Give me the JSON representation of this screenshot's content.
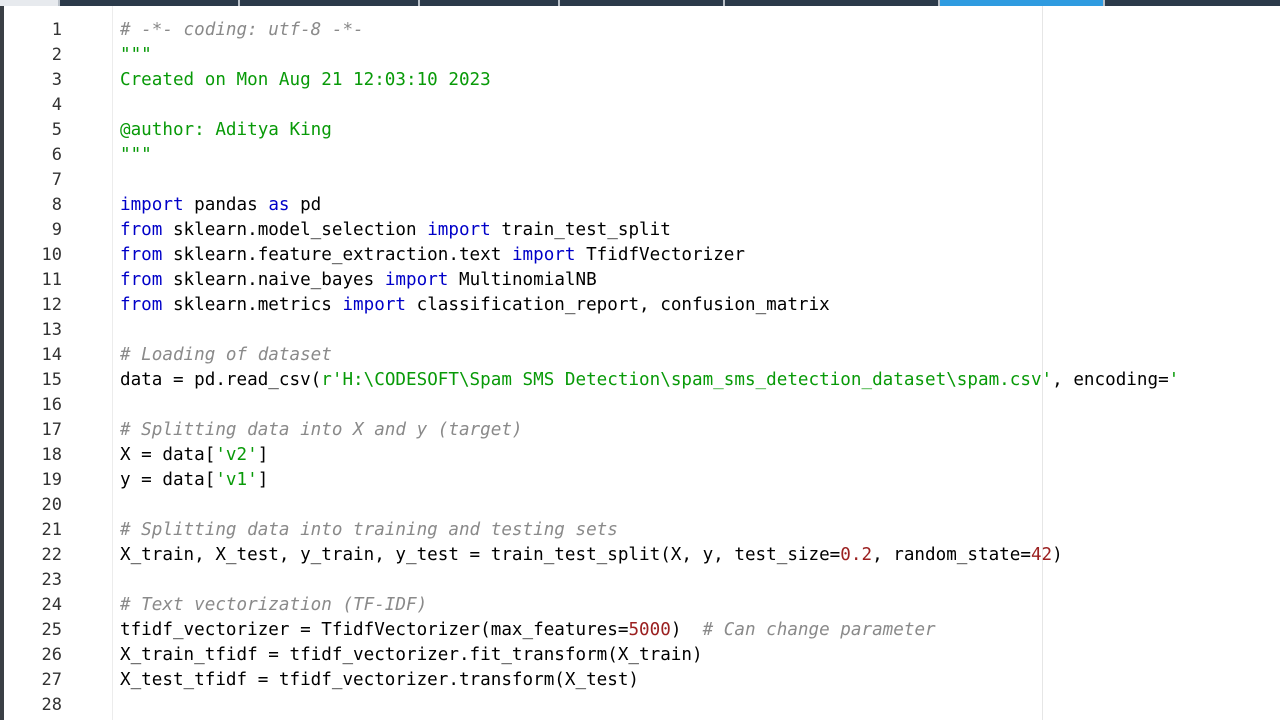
{
  "editor": {
    "tabs": [
      "",
      "",
      "",
      "",
      "",
      "",
      ""
    ],
    "lines": [
      {
        "n": "1",
        "tokens": [
          {
            "t": "cm",
            "v": "# -*- coding: utf-8 -*-"
          }
        ]
      },
      {
        "n": "2",
        "tokens": [
          {
            "t": "st",
            "v": "\"\"\""
          }
        ]
      },
      {
        "n": "3",
        "tokens": [
          {
            "t": "st",
            "v": "Created on Mon Aug 21 12:03:10 2023"
          }
        ]
      },
      {
        "n": "4",
        "tokens": []
      },
      {
        "n": "5",
        "tokens": [
          {
            "t": "st",
            "v": "@author: Aditya King"
          }
        ]
      },
      {
        "n": "6",
        "tokens": [
          {
            "t": "st",
            "v": "\"\"\""
          }
        ]
      },
      {
        "n": "7",
        "tokens": []
      },
      {
        "n": "8",
        "tokens": [
          {
            "t": "kw",
            "v": "import"
          },
          {
            "t": "pl",
            "v": " pandas "
          },
          {
            "t": "kw",
            "v": "as"
          },
          {
            "t": "pl",
            "v": " pd"
          }
        ]
      },
      {
        "n": "9",
        "tokens": [
          {
            "t": "kw",
            "v": "from"
          },
          {
            "t": "pl",
            "v": " sklearn.model_selection "
          },
          {
            "t": "kw",
            "v": "import"
          },
          {
            "t": "pl",
            "v": " train_test_split"
          }
        ]
      },
      {
        "n": "10",
        "tokens": [
          {
            "t": "kw",
            "v": "from"
          },
          {
            "t": "pl",
            "v": " sklearn.feature_extraction.text "
          },
          {
            "t": "kw",
            "v": "import"
          },
          {
            "t": "pl",
            "v": " TfidfVectorizer"
          }
        ]
      },
      {
        "n": "11",
        "tokens": [
          {
            "t": "kw",
            "v": "from"
          },
          {
            "t": "pl",
            "v": " sklearn.naive_bayes "
          },
          {
            "t": "kw",
            "v": "import"
          },
          {
            "t": "pl",
            "v": " MultinomialNB"
          }
        ]
      },
      {
        "n": "12",
        "tokens": [
          {
            "t": "kw",
            "v": "from"
          },
          {
            "t": "pl",
            "v": " sklearn.metrics "
          },
          {
            "t": "kw",
            "v": "import"
          },
          {
            "t": "pl",
            "v": " classification_report, confusion_matrix"
          }
        ]
      },
      {
        "n": "13",
        "tokens": []
      },
      {
        "n": "14",
        "tokens": [
          {
            "t": "cm",
            "v": "# Loading of dataset"
          }
        ]
      },
      {
        "n": "15",
        "tokens": [
          {
            "t": "pl",
            "v": "data = pd.read_csv("
          },
          {
            "t": "st",
            "v": "r'H:\\CODESOFT\\Spam SMS Detection\\spam_sms_detection_dataset\\spam.csv'"
          },
          {
            "t": "pl",
            "v": ", encoding="
          },
          {
            "t": "st",
            "v": "'"
          }
        ]
      },
      {
        "n": "16",
        "tokens": []
      },
      {
        "n": "17",
        "tokens": [
          {
            "t": "cm",
            "v": "# Splitting data into X and y (target)"
          }
        ]
      },
      {
        "n": "18",
        "tokens": [
          {
            "t": "pl",
            "v": "X = data["
          },
          {
            "t": "st",
            "v": "'v2'"
          },
          {
            "t": "pl",
            "v": "]"
          }
        ]
      },
      {
        "n": "19",
        "tokens": [
          {
            "t": "pl",
            "v": "y = data["
          },
          {
            "t": "st",
            "v": "'v1'"
          },
          {
            "t": "pl",
            "v": "]"
          }
        ]
      },
      {
        "n": "20",
        "tokens": []
      },
      {
        "n": "21",
        "tokens": [
          {
            "t": "cm",
            "v": "# Splitting data into training and testing sets"
          }
        ]
      },
      {
        "n": "22",
        "tokens": [
          {
            "t": "pl",
            "v": "X_train, X_test, y_train, y_test = train_test_split(X, y, test_size="
          },
          {
            "t": "nu",
            "v": "0.2"
          },
          {
            "t": "pl",
            "v": ", random_state="
          },
          {
            "t": "nu",
            "v": "42"
          },
          {
            "t": "pl",
            "v": ")"
          }
        ]
      },
      {
        "n": "23",
        "tokens": []
      },
      {
        "n": "24",
        "tokens": [
          {
            "t": "cm",
            "v": "# Text vectorization (TF-IDF)"
          }
        ]
      },
      {
        "n": "25",
        "tokens": [
          {
            "t": "pl",
            "v": "tfidf_vectorizer = TfidfVectorizer(max_features="
          },
          {
            "t": "nu",
            "v": "5000"
          },
          {
            "t": "pl",
            "v": ")  "
          },
          {
            "t": "cm",
            "v": "# Can change parameter"
          }
        ]
      },
      {
        "n": "26",
        "tokens": [
          {
            "t": "pl",
            "v": "X_train_tfidf = tfidf_vectorizer.fit_transform(X_train)"
          }
        ]
      },
      {
        "n": "27",
        "tokens": [
          {
            "t": "pl",
            "v": "X_test_tfidf = tfidf_vectorizer.transform(X_test)"
          }
        ]
      },
      {
        "n": "28",
        "tokens": []
      }
    ]
  }
}
